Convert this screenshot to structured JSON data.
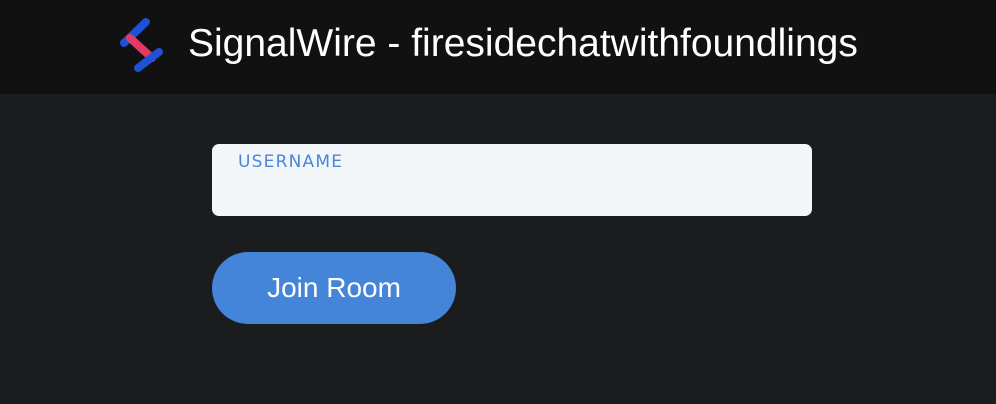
{
  "header": {
    "title": "SignalWire - firesidechatwithfoundlings",
    "logo_icon": "signalwire-logo-icon"
  },
  "form": {
    "username_label": "USERNAME",
    "username_value": "",
    "join_label": "Join Room"
  },
  "colors": {
    "header_bg": "#111111",
    "page_bg": "#1b1c1e",
    "accent": "#4485da",
    "logo_red": "#e33a63",
    "logo_blue": "#1e50d8"
  }
}
